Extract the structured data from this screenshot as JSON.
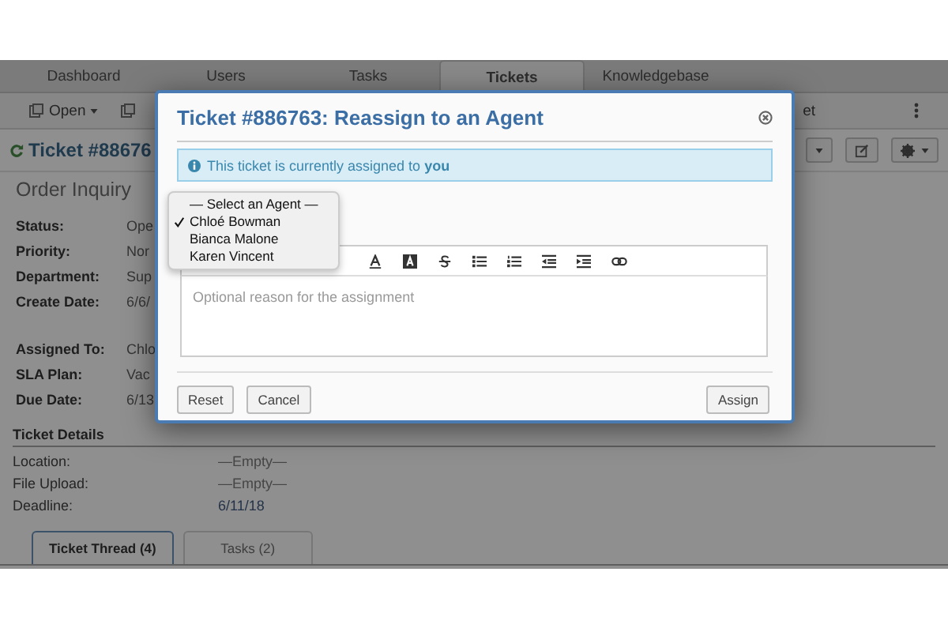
{
  "nav_tabs": [
    {
      "label": "Dashboard",
      "selected": false
    },
    {
      "label": "Users",
      "selected": false
    },
    {
      "label": "Tasks",
      "selected": false
    },
    {
      "label": "Tickets",
      "selected": true
    },
    {
      "label": "Knowledgebase",
      "selected": false
    }
  ],
  "toolbar": {
    "open_button": "Open",
    "right_fragment": "et"
  },
  "ticket": {
    "title": "Ticket #88676",
    "subject": "Order Inquiry",
    "fields": [
      {
        "label": "Status:",
        "value": "Ope"
      },
      {
        "label": "Priority:",
        "value": "Nor"
      },
      {
        "label": "Department:",
        "value": "Sup"
      },
      {
        "label": "Create Date:",
        "value": "6/6/"
      }
    ],
    "assign_fields": [
      {
        "label": "Assigned To:",
        "value": "Chlo"
      },
      {
        "label": "SLA Plan:",
        "value": "Vac"
      },
      {
        "label": "Due Date:",
        "value": "6/13"
      }
    ],
    "details_title": "Ticket Details",
    "details": [
      {
        "label": "Location:",
        "value": "—Empty—",
        "kind": "empty"
      },
      {
        "label": "File Upload:",
        "value": "—Empty—",
        "kind": "empty"
      },
      {
        "label": "Deadline:",
        "value": "6/11/18",
        "kind": "value"
      }
    ]
  },
  "thread_tabs": [
    {
      "label": "Ticket Thread (4)",
      "selected": true
    },
    {
      "label": "Tasks (2)",
      "selected": false
    }
  ],
  "modal": {
    "title": "Ticket #886763: Reassign to an Agent",
    "info": "This ticket is currently assigned to **you**",
    "agent_options": [
      {
        "label": "— Select an Agent —",
        "selected": false
      },
      {
        "label": "Chloé Bowman",
        "selected": true
      },
      {
        "label": "Bianca Malone",
        "selected": false
      },
      {
        "label": "Karen Vincent",
        "selected": false
      }
    ],
    "editor_placeholder": "Optional reason for the assignment",
    "buttons": [
      {
        "label": "Reset",
        "kind": "left"
      },
      {
        "label": "Cancel",
        "kind": "left"
      },
      {
        "label": "Assign",
        "kind": "right"
      }
    ]
  }
}
